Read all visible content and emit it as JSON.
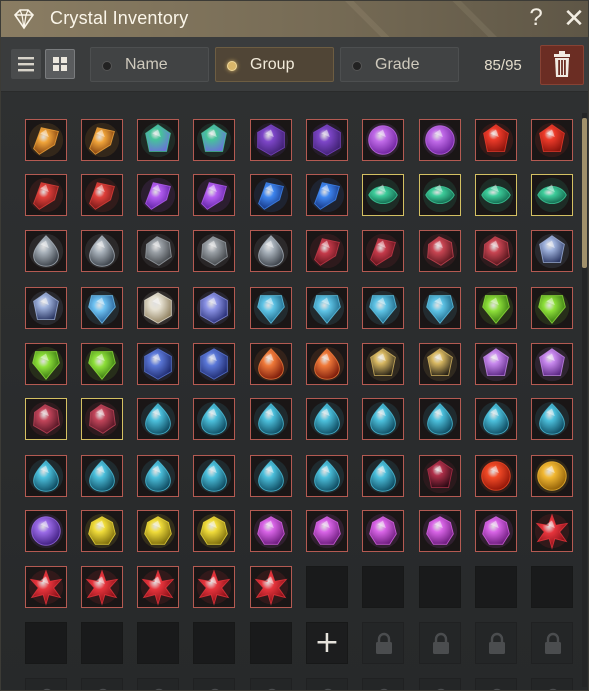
{
  "window": {
    "title": "Crystal Inventory"
  },
  "titlebar": {
    "help_label": "?",
    "close_label": "✕"
  },
  "toolbar": {
    "sort_options": [
      {
        "label": "Name",
        "selected": false
      },
      {
        "label": "Group",
        "selected": true
      },
      {
        "label": "Grade",
        "selected": false
      }
    ],
    "count": "85/95",
    "active_view": "grid"
  },
  "inventory": {
    "add_slot_label": "+",
    "rows": [
      [
        "amber-shard",
        "amber-shard",
        "teal-violet-crystal",
        "teal-violet-crystal",
        "violet-hexagon",
        "violet-hexagon",
        "purple-orb",
        "purple-orb",
        "red-gem",
        "red-gem"
      ],
      [
        "red-shard",
        "red-shard",
        "violet-shard",
        "violet-shard",
        "blue-shard",
        "blue-shard",
        "green-leaf",
        "green-leaf",
        "green-leaf",
        "green-leaf"
      ],
      [
        "grey-teardrop",
        "grey-teardrop",
        "grey-chunk",
        "grey-chunk",
        "grey-teardrop",
        "crimson-shard",
        "crimson-shard",
        "crimson-chunk",
        "crimson-chunk",
        "silver-blue-gem"
      ],
      [
        "silver-blue-gem",
        "sky-prism",
        "white-cube",
        "indigo-cube",
        "cyan-prism",
        "cyan-prism",
        "cyan-prism",
        "cyan-prism",
        "lime-prism",
        "lime-prism"
      ],
      [
        "lime-prism",
        "lime-prism",
        "blue-hex-gem",
        "blue-hex-gem",
        "fire-drop",
        "fire-drop",
        "gold-black-gem",
        "gold-black-gem",
        "lilac-gem",
        "lilac-gem"
      ],
      [
        "crimson-rough",
        "crimson-rough",
        "cyan-teardrop",
        "cyan-teardrop",
        "cyan-teardrop",
        "cyan-teardrop",
        "cyan-teardrop",
        "cyan-teardrop",
        "cyan-teardrop",
        "cyan-teardrop"
      ],
      [
        "cyan-teardrop",
        "cyan-teardrop",
        "cyan-teardrop",
        "cyan-teardrop",
        "cyan-teardrop",
        "cyan-teardrop",
        "cyan-teardrop",
        "dark-crimson-gem",
        "red-orb",
        "gold-orb"
      ],
      [
        "violet-orb",
        "yellow-cluster",
        "yellow-cluster",
        "yellow-cluster",
        "magenta-cluster",
        "magenta-cluster",
        "magenta-cluster",
        "magenta-cluster",
        "magenta-cluster",
        "red-star"
      ],
      [
        "red-star",
        "red-star",
        "red-star",
        "red-star",
        "red-star",
        "empty",
        "empty",
        "empty",
        "empty",
        "empty"
      ],
      [
        "empty",
        "empty",
        "empty",
        "empty",
        "empty",
        "add",
        "locked",
        "locked",
        "locked",
        "locked"
      ],
      [
        "locked",
        "locked",
        "locked",
        "locked",
        "locked",
        "locked",
        "locked",
        "locked",
        "locked",
        "locked"
      ]
    ],
    "gold_frames": [
      [
        1,
        6
      ],
      [
        1,
        7
      ],
      [
        1,
        8
      ],
      [
        1,
        9
      ],
      [
        5,
        0
      ],
      [
        5,
        1
      ]
    ]
  },
  "colors": {
    "amber-shard": [
      "#f0a43a",
      "#7a3a0c"
    ],
    "teal-violet-crystal": [
      "#46c49a",
      "#6a72d8"
    ],
    "violet-hexagon": [
      "#7d46c8",
      "#3c1f6e"
    ],
    "purple-orb": [
      "#c06ae8",
      "#6a1f9a"
    ],
    "red-gem": [
      "#ee3b2a",
      "#8a140c"
    ],
    "red-shard": [
      "#e0403a",
      "#6e1616"
    ],
    "violet-shard": [
      "#b35df0",
      "#5a1fa0"
    ],
    "blue-shard": [
      "#3e86f0",
      "#14307a"
    ],
    "green-leaf": [
      "#3dcc9a",
      "#0f6048"
    ],
    "grey-teardrop": [
      "#a9b2bb",
      "#3a4048"
    ],
    "grey-chunk": [
      "#9aa0a6",
      "#3b3e42"
    ],
    "crimson-shard": [
      "#c53a4a",
      "#5a1018"
    ],
    "crimson-chunk": [
      "#c84552",
      "#4c1218"
    ],
    "silver-blue-gem": [
      "#9fb2dc",
      "#2e3a66"
    ],
    "sky-prism": [
      "#6ec2f2",
      "#1b4f86"
    ],
    "white-cube": [
      "#e6e1d2",
      "#8a7a58"
    ],
    "indigo-cube": [
      "#8c94e6",
      "#232a72"
    ],
    "cyan-prism": [
      "#5fc4e6",
      "#145a7a"
    ],
    "lime-prism": [
      "#8ee03a",
      "#2e6a0c"
    ],
    "blue-hex-gem": [
      "#5b78d8",
      "#1a2566"
    ],
    "fire-drop": [
      "#f07a3a",
      "#7a1a0a"
    ],
    "gold-black-gem": [
      "#d8b862",
      "#2a2418"
    ],
    "lilac-gem": [
      "#c889ee",
      "#5e2a86"
    ],
    "crimson-rough": [
      "#c2455a",
      "#4a1220"
    ],
    "cyan-teardrop": [
      "#4cc0dc",
      "#0e4a60"
    ],
    "dark-crimson-gem": [
      "#b0304a",
      "#2c0a14"
    ],
    "red-orb": [
      "#f24a26",
      "#8a1206"
    ],
    "gold-orb": [
      "#f2b832",
      "#8a5a06"
    ],
    "violet-orb": [
      "#9a6ae6",
      "#3a1a7a"
    ],
    "yellow-cluster": [
      "#f0dc3a",
      "#7a6a0c"
    ],
    "magenta-cluster": [
      "#d864e6",
      "#6a1a7a"
    ],
    "red-star": [
      "#e6343c",
      "#7a0a12"
    ]
  }
}
